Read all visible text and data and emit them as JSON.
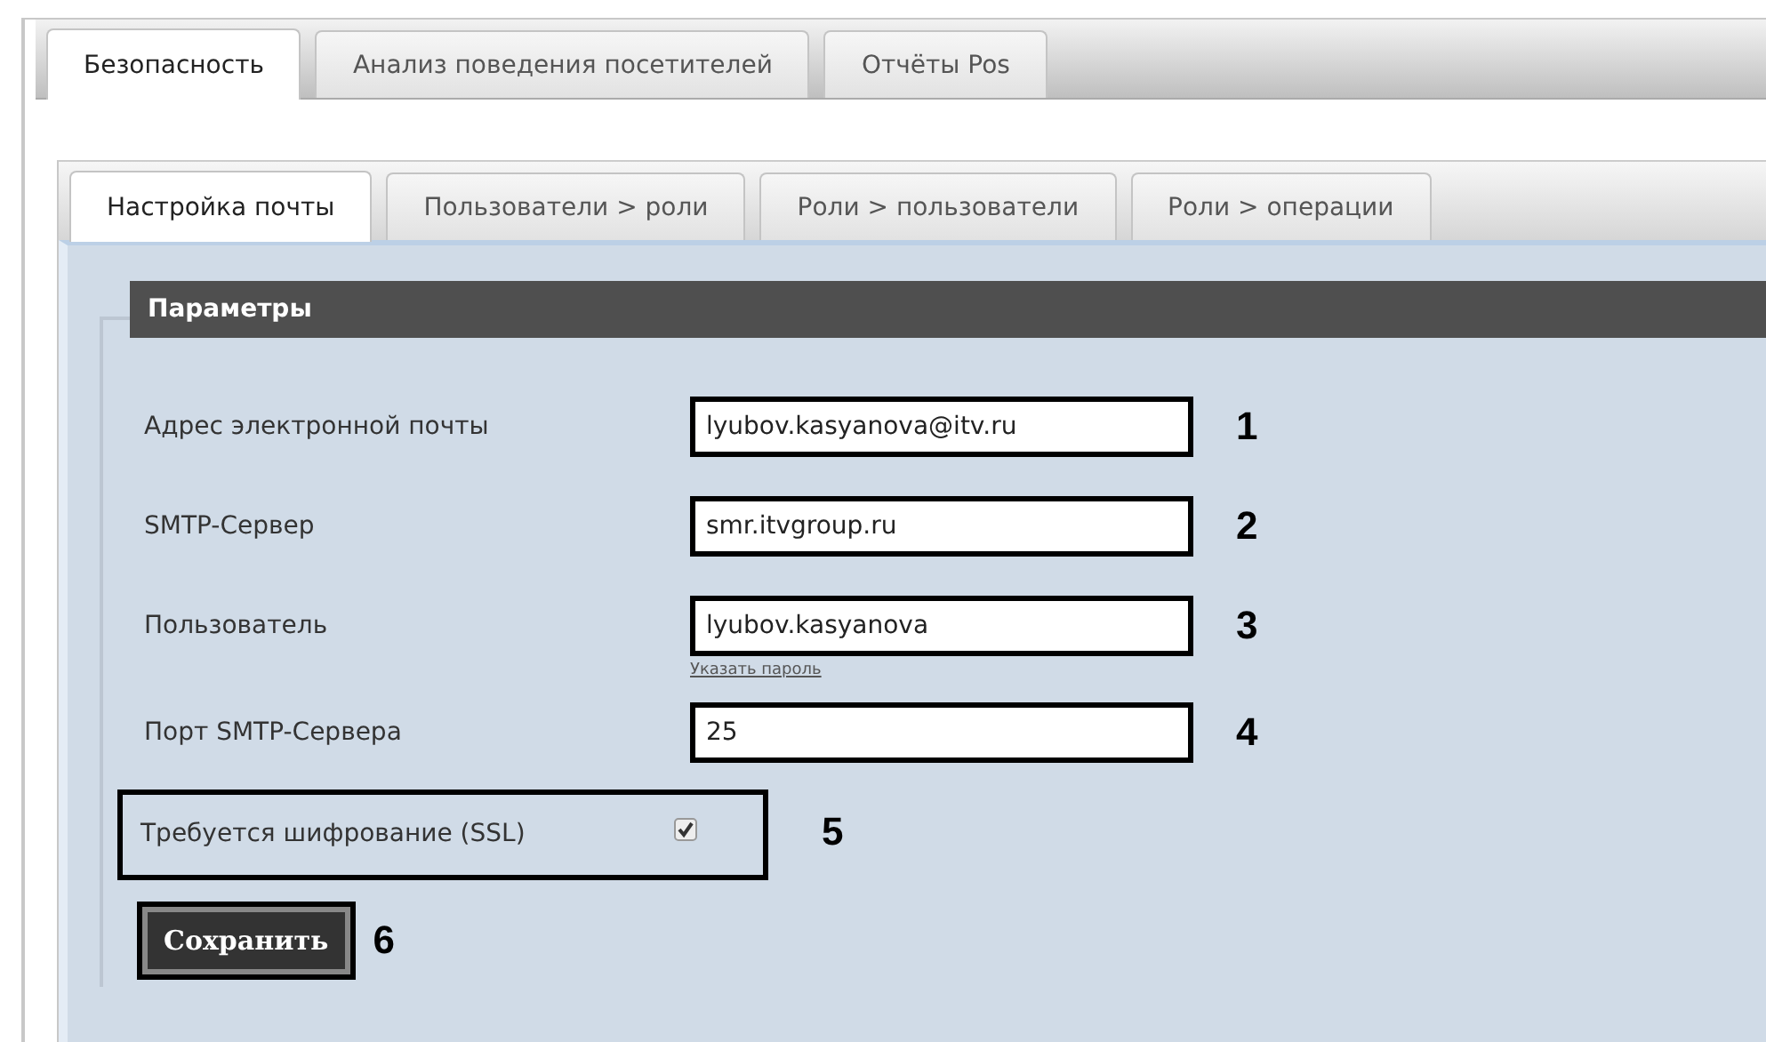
{
  "tabs": [
    {
      "label": "Безопасность",
      "selected": true
    },
    {
      "label": "Анализ поведения посетителей",
      "selected": false
    },
    {
      "label": "Отчёты Pos",
      "selected": false
    }
  ],
  "subtabs": [
    {
      "label": "Настройка почты",
      "selected": true
    },
    {
      "label": "Пользователи > роли",
      "selected": false
    },
    {
      "label": "Роли > пользователи",
      "selected": false
    },
    {
      "label": "Роли > операции",
      "selected": false
    }
  ],
  "fieldset": {
    "legend": "Параметры",
    "fields": [
      {
        "kind": "text",
        "label": "Адрес электронной почты",
        "value": "lyubov.kasyanova@itv.ru",
        "callout": "1"
      },
      {
        "kind": "text",
        "label": "SMTP-Сервер",
        "value": "smr.itvgroup.ru",
        "callout": "2"
      },
      {
        "kind": "text",
        "label": "Пользователь",
        "value": "lyubov.kasyanova",
        "callout": "3",
        "link": "Указать пароль"
      },
      {
        "kind": "text",
        "label": "Порт SMTP-Сервера",
        "value": "25",
        "callout": "4"
      },
      {
        "kind": "checkbox",
        "label": "Требуется шифрование (SSL)",
        "checked": true,
        "callout": "5"
      }
    ],
    "save_button": {
      "label": "Сохранить",
      "callout": "6"
    }
  }
}
